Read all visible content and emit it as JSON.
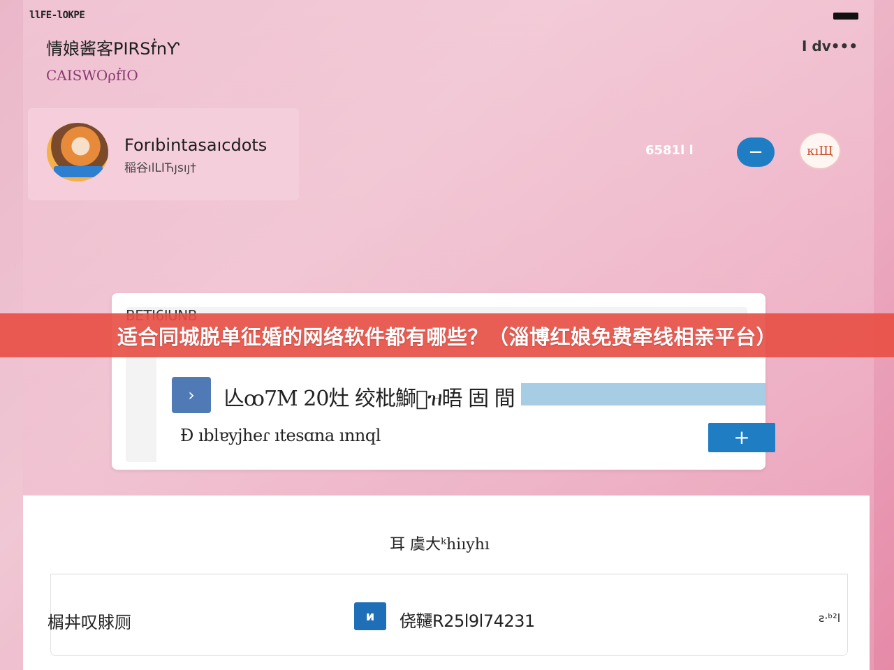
{
  "status_bar": {
    "left_text": "llFE-lOKPE"
  },
  "header": {
    "title": "情娘酱客PIRSḟnƳ",
    "subtitle": "CAISWOρḟIO",
    "more_label": "I dv•••"
  },
  "profile": {
    "name": "Forıbintasaıcdots",
    "meta": "稲谷ılLIЋȷsıյ†",
    "count": "6581l l",
    "minus_label": "−",
    "badge_text": "ᴋıЩ"
  },
  "banner": {
    "text": "适合同城脱单征婚的网络软件都有哪些？（淄博红娘免费牵线相亲平台）"
  },
  "dialog": {
    "heading": "BETI6IUNB",
    "item_icon": "›",
    "item_title": "亾ꝏ7M 20灶 绞枇鰤\u0000ዝ晤 固 間",
    "item_desc": "Ɖ ıblɐyjheɾ ıtesɑna ınnql",
    "plus_label": "+"
  },
  "bottom": {
    "heading": "耳 虞大ᵏhiıyhı",
    "row_left": "榍丼叹賕厕",
    "row_icon": "ᴎ",
    "row_code": "侥韆R25l9l74231",
    "row_right": "ꙅ·ᵇ²l"
  },
  "colors": {
    "accent_blue": "#1f7dc4",
    "banner_red": "#e84e42",
    "background_pink": "#eab7c9"
  }
}
